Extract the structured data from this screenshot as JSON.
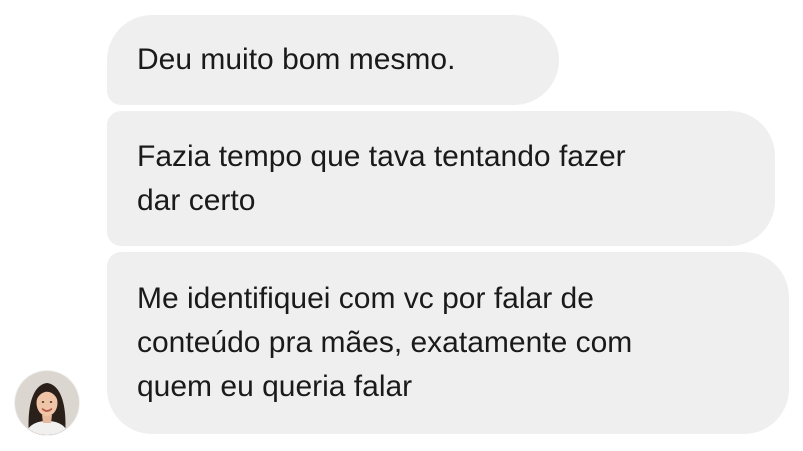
{
  "messages": [
    {
      "lines": [
        "Deu muito bom mesmo."
      ]
    },
    {
      "lines": [
        "Fazia tempo que tava tentando fazer",
        "dar certo"
      ]
    },
    {
      "lines": [
        "Me identifiquei com vc por falar de",
        "conteúdo pra mães, exatamente com",
        "quem eu queria falar"
      ]
    }
  ],
  "sender": {
    "avatar_icon": "profile-photo-woman"
  },
  "colors": {
    "bubble_background": "#efefef",
    "text": "#1a1a1a",
    "page_background": "#ffffff"
  }
}
